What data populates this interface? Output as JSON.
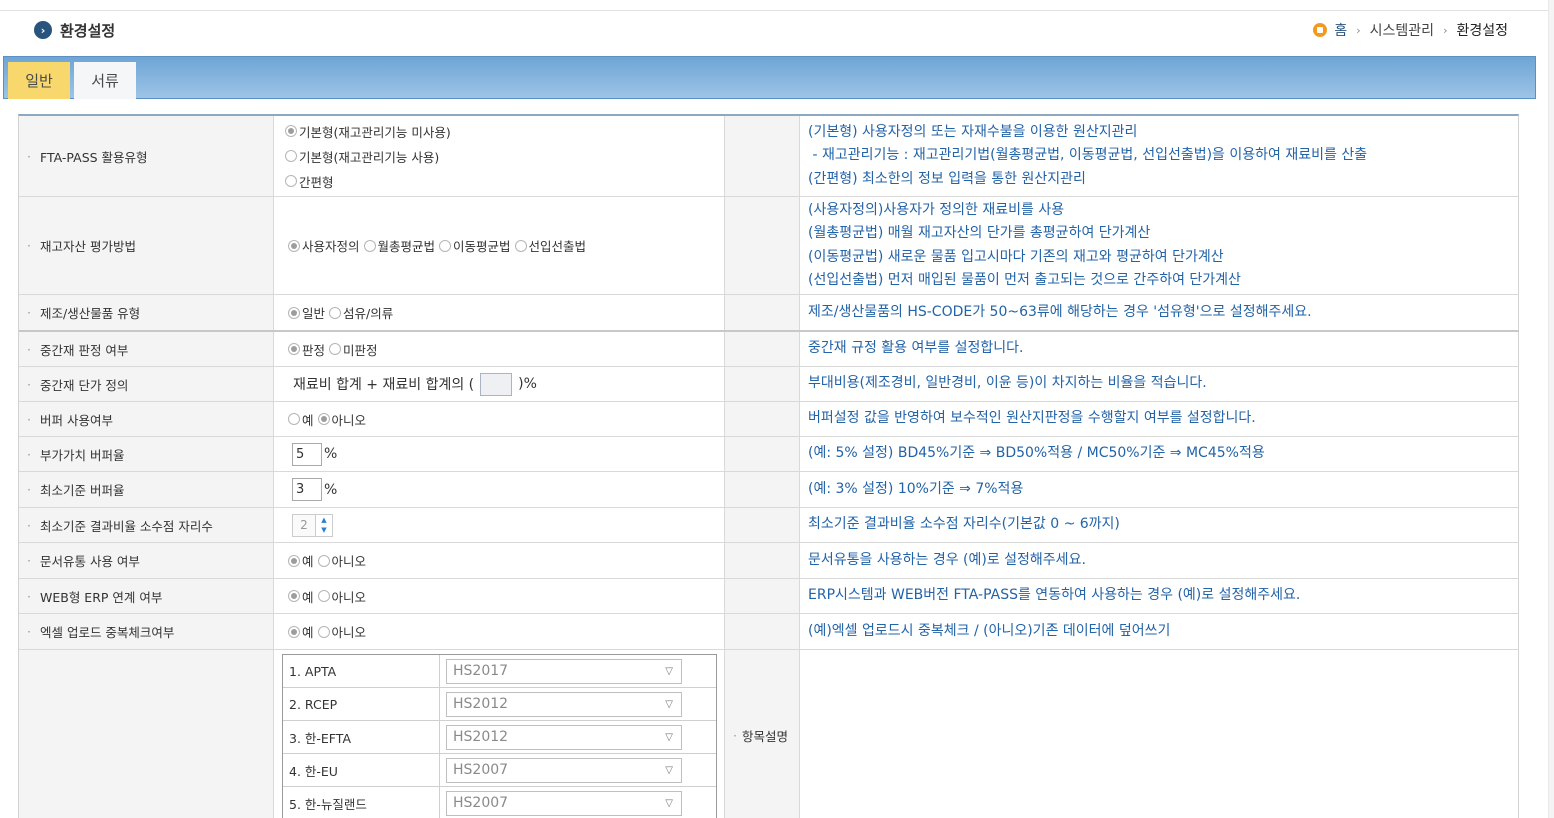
{
  "page": {
    "title": "환경설정"
  },
  "breadcrumb": {
    "home": "홈",
    "section": "시스템관리",
    "current": "환경설정"
  },
  "tabs": [
    {
      "label": "일반",
      "active": true
    },
    {
      "label": "서류",
      "active": false
    }
  ],
  "colors": {
    "accent": "#29547e",
    "tab_active": "#f8d86c",
    "desc_text": "#2363a8",
    "tab_bar": "#6ea5d5"
  },
  "rows": {
    "fta_type": {
      "label": "FTA-PASS 활용유형",
      "options": [
        "기본형(재고관리기능 미사용)",
        "기본형(재고관리기능 사용)",
        "간편형"
      ],
      "selected": "기본형(재고관리기능 미사용)",
      "desc": [
        "(기본형) 사용자정의 또는 자재수불을 이용한 원산지관리",
        " - 재고관리기능 : 재고관리기법(월총평균법, 이동평균법, 선입선출법)을 이용하여 재료비를 산출",
        "(간편형) 최소한의 정보 입력을 통한 원산지관리"
      ]
    },
    "inventory_method": {
      "label": "재고자산 평가방법",
      "options": [
        "사용자정의",
        "월총평균법",
        "이동평균법",
        "선입선출법"
      ],
      "selected": "사용자정의",
      "desc": [
        "(사용자정의)사용자가 정의한 재료비를 사용",
        "(월총평균법) 매월 재고자산의 단가를 총평균하여 단가계산",
        "(이동평균법) 새로운 물품 입고시마다 기존의 재고와 평균하여 단가계산",
        "(선입선출법) 먼저 매입된 물품이 먼저 출고되는 것으로 간주하여 단가계산"
      ]
    },
    "product_type": {
      "label": "제조/생산물품 유형",
      "options": [
        "일반",
        "섬유/의류"
      ],
      "selected": "일반",
      "desc": "제조/생산물품의 HS-CODE가 50~63류에 해당하는 경우 '섬유형'으로 설정해주세요."
    },
    "intermediate_judge": {
      "label": "중간재 판정 여부",
      "options": [
        "판정",
        "미판정"
      ],
      "selected": "판정",
      "desc": "중간재 규정 활용 여부를 설정합니다."
    },
    "intermediate_price": {
      "label": "중간재 단가 정의",
      "formula_prefix": "재료비 합계 + 재료비 합계의 (",
      "formula_suffix": ")%",
      "desc": "부대비용(제조경비, 일반경비, 이윤 등)이 차지하는 비율을 적습니다."
    },
    "buffer_use": {
      "label": "버퍼 사용여부",
      "options": [
        "예",
        "아니오"
      ],
      "selected": "아니오",
      "desc": "버퍼설정 값을 반영하여 보수적인 원산지판정을 수행할지 여부를 설정합니다."
    },
    "value_buffer": {
      "label": "부가가치 버퍼율",
      "value": "5",
      "unit": "%",
      "desc": "(예: 5% 설정) BD45%기준 ⇒ BD50%적용 / MC50%기준 ⇒ MC45%적용"
    },
    "min_buffer": {
      "label": "최소기준 버퍼율",
      "value": "3",
      "unit": "%",
      "desc": "(예: 3% 설정) 10%기준 ⇒ 7%적용"
    },
    "decimal_places": {
      "label": "최소기준 결과비율 소수점 자리수",
      "value": "2",
      "desc": "최소기준 결과비율 소수점 자리수(기본값 0 ~ 6까지)"
    },
    "doc_flow": {
      "label": "문서유통 사용 여부",
      "options": [
        "예",
        "아니오"
      ],
      "selected": "예",
      "desc": "문서유통을 사용하는 경우 (예)로 설정해주세요."
    },
    "web_erp": {
      "label": "WEB형 ERP 연계 여부",
      "options": [
        "예",
        "아니오"
      ],
      "selected": "예",
      "desc": "ERP시스템과 WEB버전 FTA-PASS를 연동하여 사용하는 경우 (예)로 설정해주세요."
    },
    "excel_dup": {
      "label": "엑셀 업로드 중복체크여부",
      "options": [
        "예",
        "아니오"
      ],
      "selected": "예",
      "desc": "(예)엑셀 업로드시 중복체크 / (아니오)기존 데이터에 덮어쓰기"
    }
  },
  "item_desc_label": "항목설명",
  "fta_hs": [
    {
      "name": "1. APTA",
      "value": "HS2017"
    },
    {
      "name": "2. RCEP",
      "value": "HS2012"
    },
    {
      "name": "3. 한-EFTA",
      "value": "HS2012"
    },
    {
      "name": "4. 한-EU",
      "value": "HS2007"
    },
    {
      "name": "5. 한-뉴질랜드",
      "value": "HS2007"
    }
  ]
}
